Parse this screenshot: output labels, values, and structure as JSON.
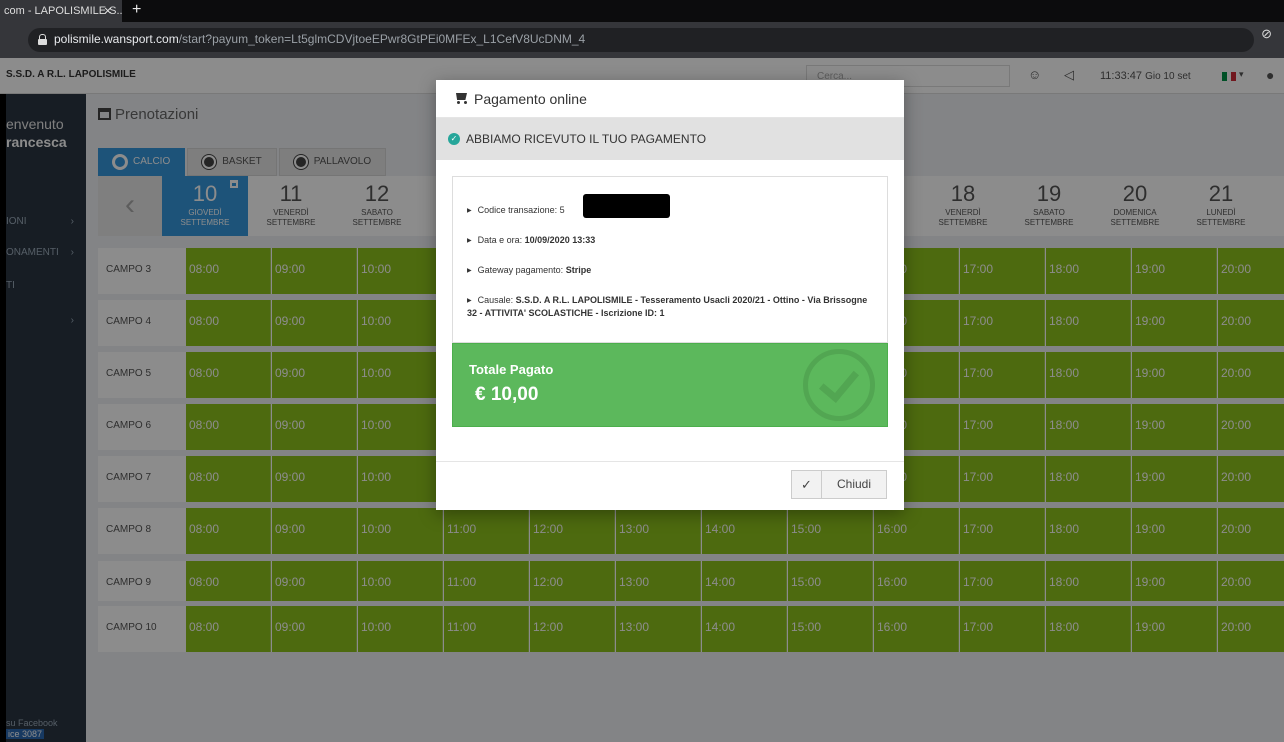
{
  "browser": {
    "tab_title": "com - LAPOLISMILE S...",
    "tab_close": "×",
    "new_tab": "+",
    "url_host": "polismile.wansport.com",
    "url_path": "/start?payum_token=Lt5glmCDVjtoeEPwr8GtPEi0MFEx_L1CefV8UcDNM_4"
  },
  "app": {
    "brand": "S.S.D. A R.L. LAPOLISMILE",
    "search_placeholder": "Cerca...",
    "time": "11:33:47",
    "date": "Gio 10 set"
  },
  "sidebar": {
    "welcome": "envenuto",
    "user": "rancesca",
    "items": [
      {
        "label": "IONI",
        "arrow": "›"
      },
      {
        "label": "ONAMENTI",
        "arrow": "›"
      },
      {
        "label": "TI",
        "arrow": ""
      },
      {
        "label": "",
        "arrow": "›"
      }
    ],
    "footer_line1": "su Facebook",
    "footer_line2": "ice 3087"
  },
  "main": {
    "title": "Prenotazioni",
    "tabs": [
      "CALCIO",
      "BASKET",
      "PALLAVOLO"
    ],
    "prev": "‹",
    "days": [
      {
        "num": "10",
        "wd": "GIOVEDÌ",
        "mo": "SETTEMBRE"
      },
      {
        "num": "11",
        "wd": "VENERDÌ",
        "mo": "SETTEMBRE"
      },
      {
        "num": "12",
        "wd": "SABATO",
        "mo": "SETTEMBRE"
      },
      {
        "num": "18",
        "wd": "VENERDÌ",
        "mo": "SETTEMBRE"
      },
      {
        "num": "19",
        "wd": "SABATO",
        "mo": "SETTEMBRE"
      },
      {
        "num": "20",
        "wd": "DOMENICA",
        "mo": "SETTEMBRE"
      },
      {
        "num": "21",
        "wd": "LUNEDÌ",
        "mo": "SETTEMBRE"
      }
    ],
    "fields": [
      "CAMPO 3",
      "CAMPO 4",
      "CAMPO 5",
      "CAMPO 6",
      "CAMPO 7",
      "CAMPO 8",
      "CAMPO 9",
      "CAMPO 10"
    ],
    "times": [
      "08:00",
      "09:00",
      "10:00",
      "11:00",
      "12:00",
      "13:00",
      "14:00",
      "15:00",
      "16:00",
      "17:00",
      "18:00",
      "19:00",
      "20:00"
    ],
    "slot_color": "#8cc11c"
  },
  "modal": {
    "title": "Pagamento online",
    "success": "ABBIAMO RICEVUTO IL TUO PAGAMENTO",
    "code_label": "Codice transazione: ",
    "code_value": "5",
    "datetime_label": "Data e ora: ",
    "datetime_value": "10/09/2020 13:33",
    "gateway_label": "Gateway pagamento: ",
    "gateway_value": "Stripe",
    "reason_label": "Causale: ",
    "reason_value": "S.S.D. A R.L. LAPOLISMILE - Tesseramento Usacli 2020/21 - Ottino - Via Brissogne 32 - ATTIVITA' SCOLASTICHE - Iscrizione ID: 1",
    "total_label": "Totale Pagato",
    "total_amount": "€ 10,00",
    "close_icon": "✓",
    "close_label": "Chiudi",
    "success_color": "#5cb85c"
  }
}
